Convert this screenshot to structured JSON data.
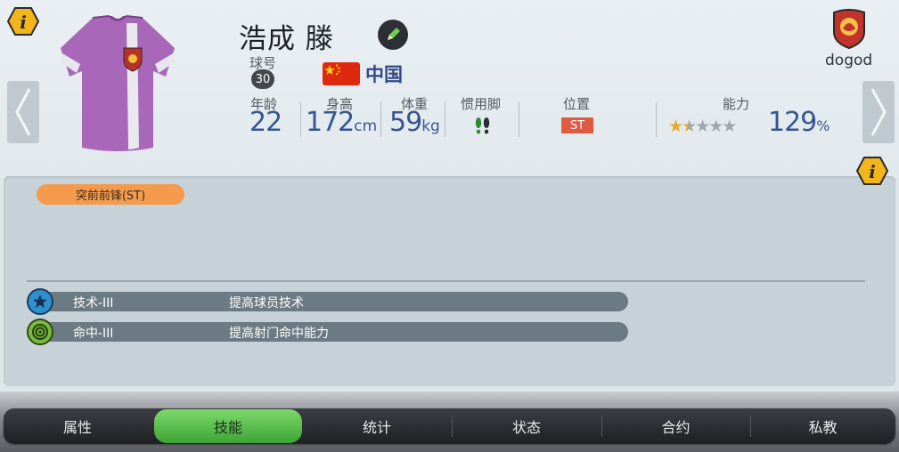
{
  "header": {
    "player_name": "浩成 滕",
    "number_label": "球号",
    "number": "30",
    "country": "中国",
    "stats": [
      {
        "label": "年龄",
        "value": "22",
        "unit": ""
      },
      {
        "label": "身高",
        "value": "172",
        "unit": "cm"
      },
      {
        "label": "体重",
        "value": "59",
        "unit": "kg"
      }
    ],
    "foot_label": "惯用脚",
    "position_label": "位置",
    "position": "ST",
    "ability_label": "能力",
    "ability_stars": 1.5,
    "ability_stars_max": 5,
    "ability_value": "129",
    "ability_unit": "%",
    "club_name": "dogod"
  },
  "panel": {
    "role": "突前前锋(ST)",
    "skills": [
      {
        "name": "技术-III",
        "description": "提高球员技术",
        "icon": "star-icon"
      },
      {
        "name": "命中-III",
        "description": "提高射门命中能力",
        "icon": "target-icon"
      }
    ]
  },
  "tabs": [
    {
      "label": "属性",
      "active": false
    },
    {
      "label": "技能",
      "active": true
    },
    {
      "label": "统计",
      "active": false
    },
    {
      "label": "状态",
      "active": false
    },
    {
      "label": "合约",
      "active": false
    },
    {
      "label": "私教",
      "active": false
    }
  ],
  "colors": {
    "accent_blue": "#35578f",
    "position_badge": "#e05a42",
    "role_pill": "#f39a4c",
    "active_tab": "#4fbf44",
    "jersey": "#a867b8"
  }
}
